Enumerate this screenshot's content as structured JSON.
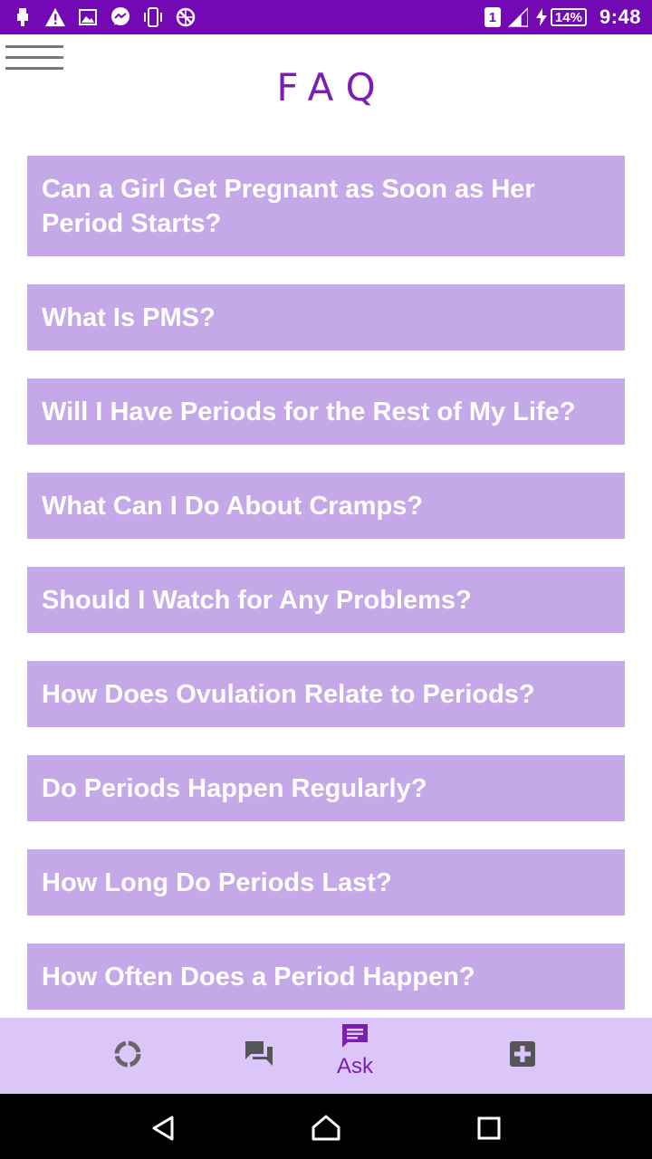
{
  "status_bar": {
    "sim": "1",
    "battery": "14%",
    "time": "9:48",
    "icons": [
      "usb-icon",
      "warning-icon",
      "image-icon",
      "messenger-icon",
      "phone-vibrate-icon",
      "no-location-icon",
      "signal-icon",
      "charging-icon"
    ],
    "background": "#7309b5"
  },
  "header": {
    "title": "FAQ",
    "menu_icon": "hamburger-menu-icon"
  },
  "faq": {
    "item_color": "#c4a8e8",
    "items": [
      {
        "label": "Can a Girl Get Pregnant as Soon as Her Period Starts?"
      },
      {
        "label": "What Is PMS?"
      },
      {
        "label": "Will I Have Periods for the Rest of My Life?"
      },
      {
        "label": "What Can I Do About Cramps?"
      },
      {
        "label": "Should I Watch for Any Problems?"
      },
      {
        "label": "How Does Ovulation Relate to Periods?"
      },
      {
        "label": "Do Periods Happen Regularly?"
      },
      {
        "label": "How Long Do Periods Last?"
      },
      {
        "label": "How Often Does a Period Happen?"
      }
    ]
  },
  "tab_bar": {
    "background": "#dcc6f9",
    "tabs": [
      {
        "icon": "cycle-icon",
        "label": ""
      },
      {
        "icon": "forum-icon",
        "label": ""
      },
      {
        "icon": "ask-chat-icon",
        "label": "Ask",
        "active": true
      },
      {
        "icon": "medical-plus-icon",
        "label": ""
      }
    ]
  },
  "nav_bar": {
    "buttons": [
      "back-icon",
      "home-icon",
      "recents-icon"
    ]
  }
}
